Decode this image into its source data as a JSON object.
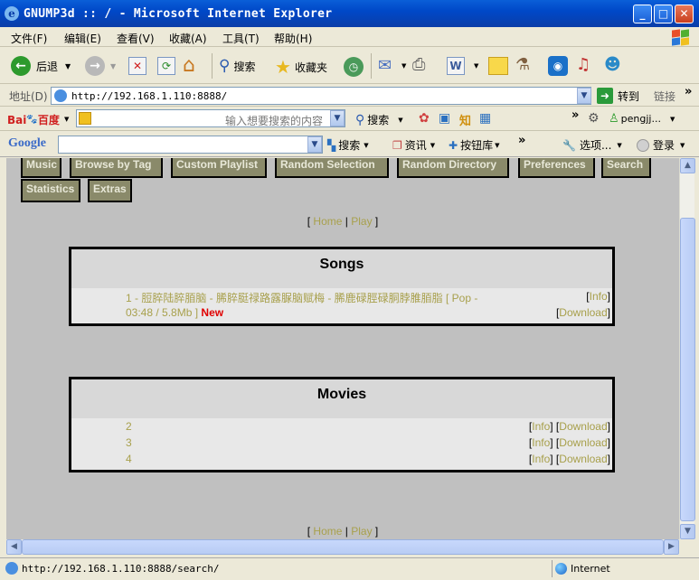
{
  "window": {
    "title": "GNUMP3d :: / - Microsoft Internet Explorer"
  },
  "menu": [
    "文件(F)",
    "编辑(E)",
    "查看(V)",
    "收藏(A)",
    "工具(T)",
    "帮助(H)"
  ],
  "toolbar": {
    "back": "后退",
    "search": "搜索",
    "favorites": "收藏夹"
  },
  "address": {
    "label": "地址(D)",
    "url": "http://192.168.1.110:8888/",
    "go": "转到",
    "links": "链接"
  },
  "baidu": {
    "logo_left": "Bai",
    "logo_right": "百度",
    "placeholder": "输入想要搜索的内容",
    "search": "搜索",
    "user": "pengjj..."
  },
  "google": {
    "logo": "Google",
    "search": "搜索",
    "news": "资讯",
    "buttons": "按钮库",
    "options": "选项...",
    "login": "登录"
  },
  "page": {
    "nav": [
      "Music",
      "Browse by Tag",
      "Custom Playlist",
      "Random Selection",
      "Random Directory",
      "Preferences",
      "Search",
      "Statistics",
      "Extras"
    ],
    "links": {
      "home": "Home",
      "play": "Play",
      "sep": "|",
      "open": "[",
      "close": "]"
    },
    "songs": {
      "title": "Songs",
      "items": [
        {
          "line1": "1 - 脰脺陆脺脜脑  - 脪脺脡禄路露脲脑赋梅  - 脪鹿碌脛碌胴脖脽脜脂  [ Pop -",
          "line2": "03:48 / 5.8Mb ]",
          "new": "New",
          "info": "Info",
          "download": "Download"
        }
      ]
    },
    "movies": {
      "title": "Movies",
      "items": [
        {
          "name": "2",
          "info": "Info",
          "download": "Download"
        },
        {
          "name": "3",
          "info": "Info",
          "download": "Download"
        },
        {
          "name": "4",
          "info": "Info",
          "download": "Download"
        }
      ]
    }
  },
  "status": {
    "url": "http://192.168.1.110:8888/search/",
    "zone": "Internet"
  }
}
